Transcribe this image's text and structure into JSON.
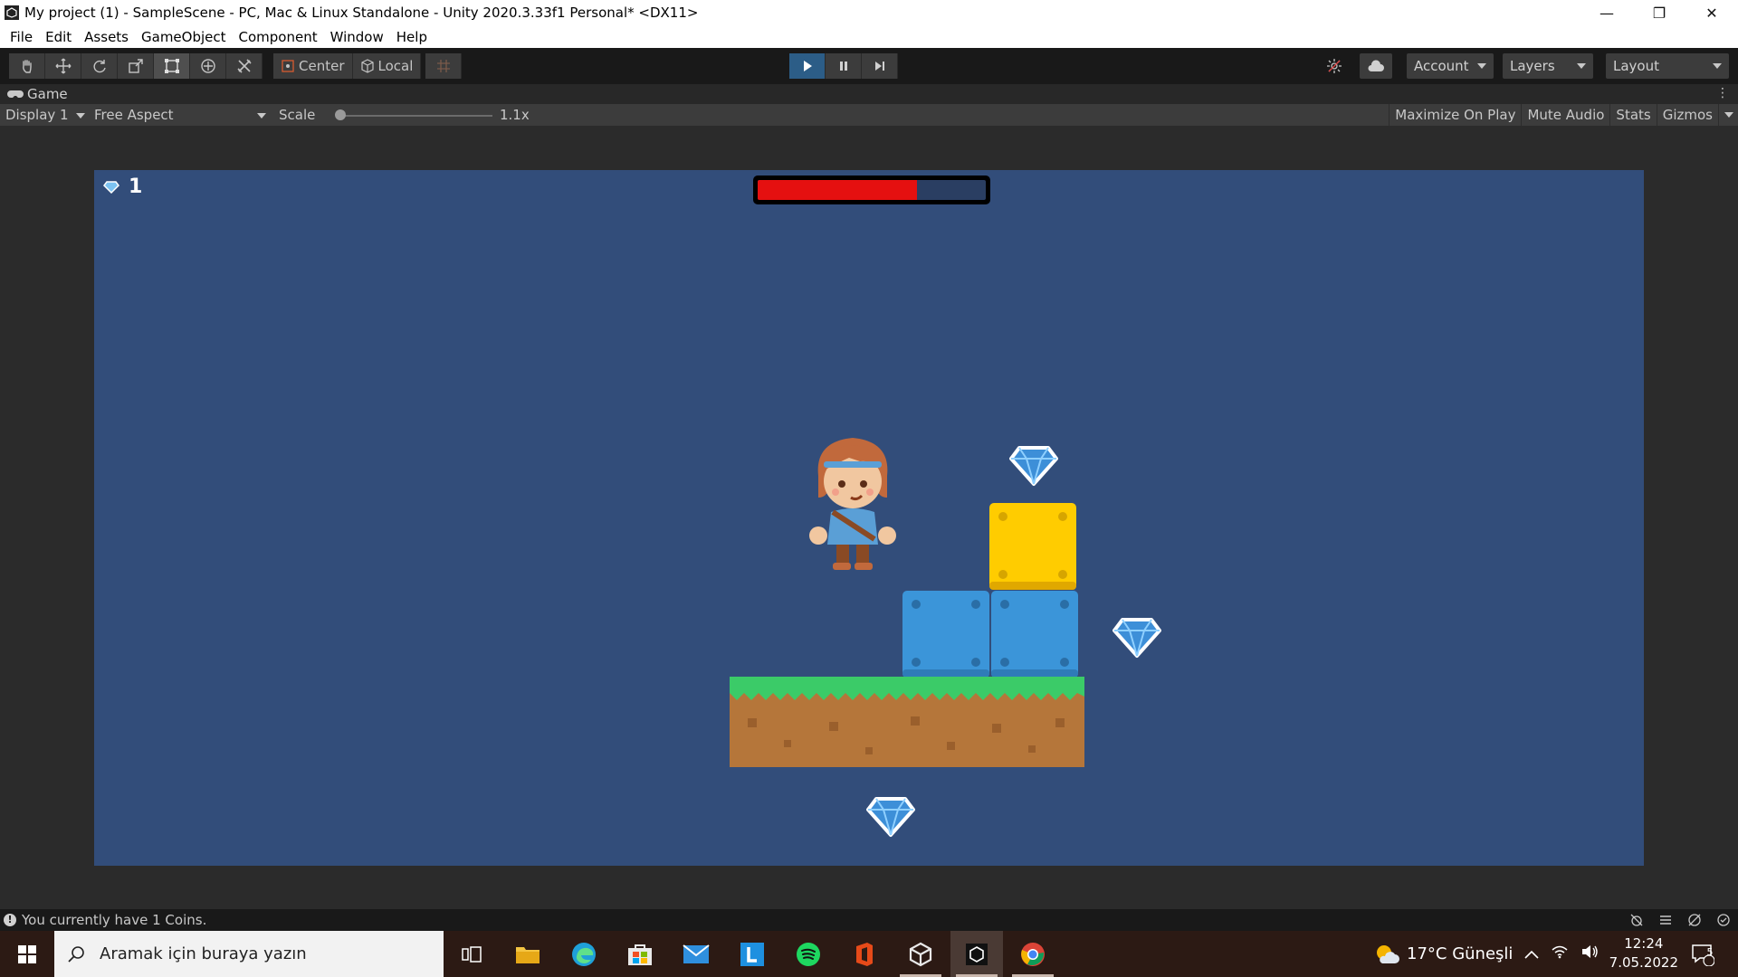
{
  "window": {
    "title": "My project (1) - SampleScene - PC, Mac & Linux Standalone - Unity 2020.3.33f1 Personal* <DX11>",
    "minimize": "—",
    "restore": "❐",
    "close": "✕"
  },
  "menu": [
    "File",
    "Edit",
    "Assets",
    "GameObject",
    "Component",
    "Window",
    "Help"
  ],
  "toolbar": {
    "tools": [
      "hand-tool",
      "move-tool",
      "rotate-tool",
      "scale-tool",
      "rect-tool",
      "transform-tool",
      "custom-tool"
    ],
    "active_tool": "rect-tool",
    "pivot_label": "Center",
    "space_label": "Local",
    "account_label": "Account",
    "layers_label": "Layers",
    "layout_label": "Layout",
    "play_state": "playing"
  },
  "game_tab": {
    "label": "Game"
  },
  "game_toolbar": {
    "display": "Display 1",
    "aspect": "Free Aspect",
    "scale_label": "Scale",
    "scale_value": "1.1x",
    "scale_fraction": 0.02,
    "maximize": "Maximize On Play",
    "mute": "Mute Audio",
    "stats": "Stats",
    "gizmos": "Gizmos"
  },
  "game": {
    "coins": "1",
    "health_fraction": 0.7,
    "colors": {
      "background": "#324d7a",
      "health_fill": "#e51010",
      "yellow_block": "#ffcc00",
      "blue_block": "#3b95d9",
      "grass": "#3bcb68",
      "dirt": "#b5763a"
    }
  },
  "status": {
    "message": "You currently have 1 Coins."
  },
  "taskbar": {
    "search_placeholder": "Aramak için buraya yazın",
    "apps": [
      "task-view",
      "file-explorer",
      "edge",
      "store",
      "mail",
      "l-app",
      "spotify",
      "office",
      "unity",
      "visual-studio",
      "chrome"
    ],
    "weather": "17°C  Güneşli",
    "time": "12:24",
    "date": "7.05.2022",
    "notifications": "5"
  }
}
